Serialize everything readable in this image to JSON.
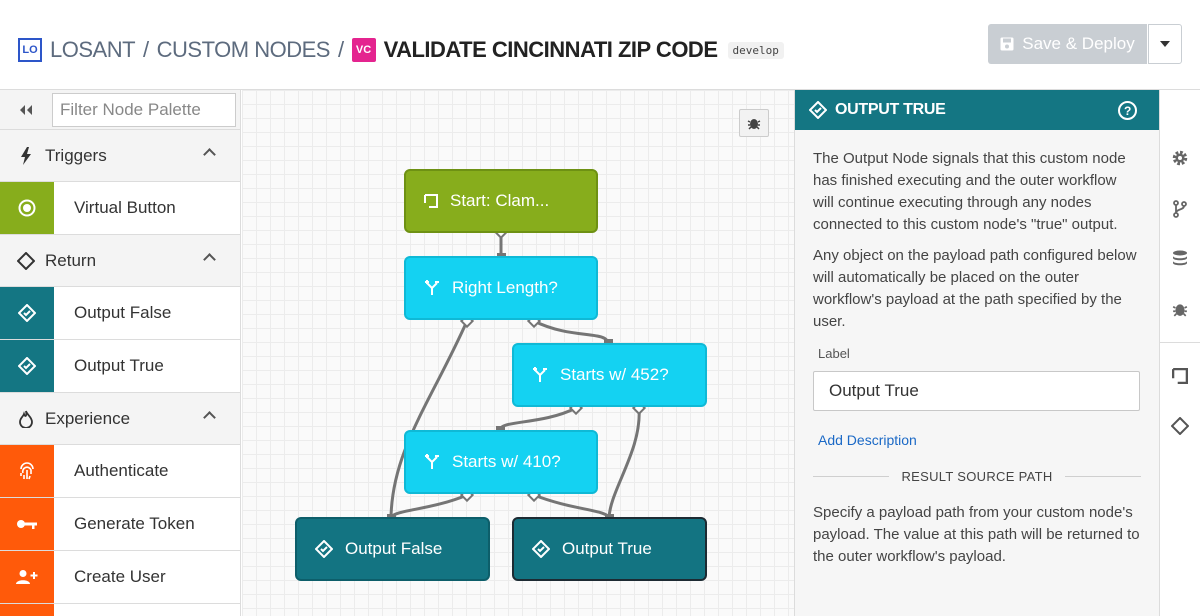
{
  "header": {
    "logo_badge": "LO",
    "crumb_root": "LOSANT",
    "crumb_section": "CUSTOM NODES",
    "node_badge": "VC",
    "title": "VALIDATE CINCINNATI ZIP CODE",
    "branch": "develop",
    "save_label": "Save & Deploy",
    "colors": {
      "logo": "#2d56c9",
      "node_badge": "#e4248f",
      "save_disabled": "#c9ced3"
    }
  },
  "palette": {
    "collapse_icon": "double-chevron-left-icon",
    "filter_placeholder": "Filter Node Palette",
    "categories": [
      {
        "label": "Triggers",
        "icon": "lightning-icon",
        "items": [
          {
            "label": "Virtual Button",
            "icon": "virtual-button-icon",
            "color": "#87ad1c"
          }
        ]
      },
      {
        "label": "Return",
        "icon": "diamond-icon",
        "items": [
          {
            "label": "Output False",
            "icon": "output-icon",
            "color": "#147683"
          },
          {
            "label": "Output True",
            "icon": "output-icon",
            "color": "#147683"
          }
        ]
      },
      {
        "label": "Experience",
        "icon": "flame-icon",
        "items": [
          {
            "label": "Authenticate",
            "icon": "fingerprint-icon",
            "color": "#ff5a0a"
          },
          {
            "label": "Generate Token",
            "icon": "key-icon",
            "color": "#ff5a0a"
          },
          {
            "label": "Create User",
            "icon": "add-user-icon",
            "color": "#ff5a0a"
          }
        ]
      }
    ]
  },
  "canvas": {
    "nodes": {
      "start": "Start: Clam...",
      "right_length": "Right Length?",
      "starts_452": "Starts w/ 452?",
      "starts_410": "Starts w/ 410?",
      "output_false": "Output False",
      "output_true": "Output True"
    },
    "colors": {
      "trigger": "#87ad1c",
      "conditional": "#14d2f2",
      "output": "#137482",
      "wire": "#757575"
    }
  },
  "panel": {
    "title": "OUTPUT TRUE",
    "help_icon": "?",
    "description_1": "The Output Node signals that this custom node has finished executing and the outer workflow will continue executing through any nodes connected to this custom node's \"true\" output.",
    "description_2": "Any object on the payload path configured below will automatically be placed on the outer workflow's payload at the path specified by the user.",
    "label_caption": "Label",
    "label_value": "Output True",
    "add_description": "Add Description",
    "section_title": "RESULT SOURCE PATH",
    "spec_text": "Specify a payload path from your custom node's payload. The value at this path will be returned to the outer workflow's payload.",
    "colors": {
      "header": "#147683",
      "link": "#1b69c6"
    }
  },
  "rail": {
    "icons": [
      "gear-icon",
      "branch-icon",
      "database-icon",
      "bug-icon",
      "trigger-square-icon",
      "diamond-icon"
    ]
  }
}
